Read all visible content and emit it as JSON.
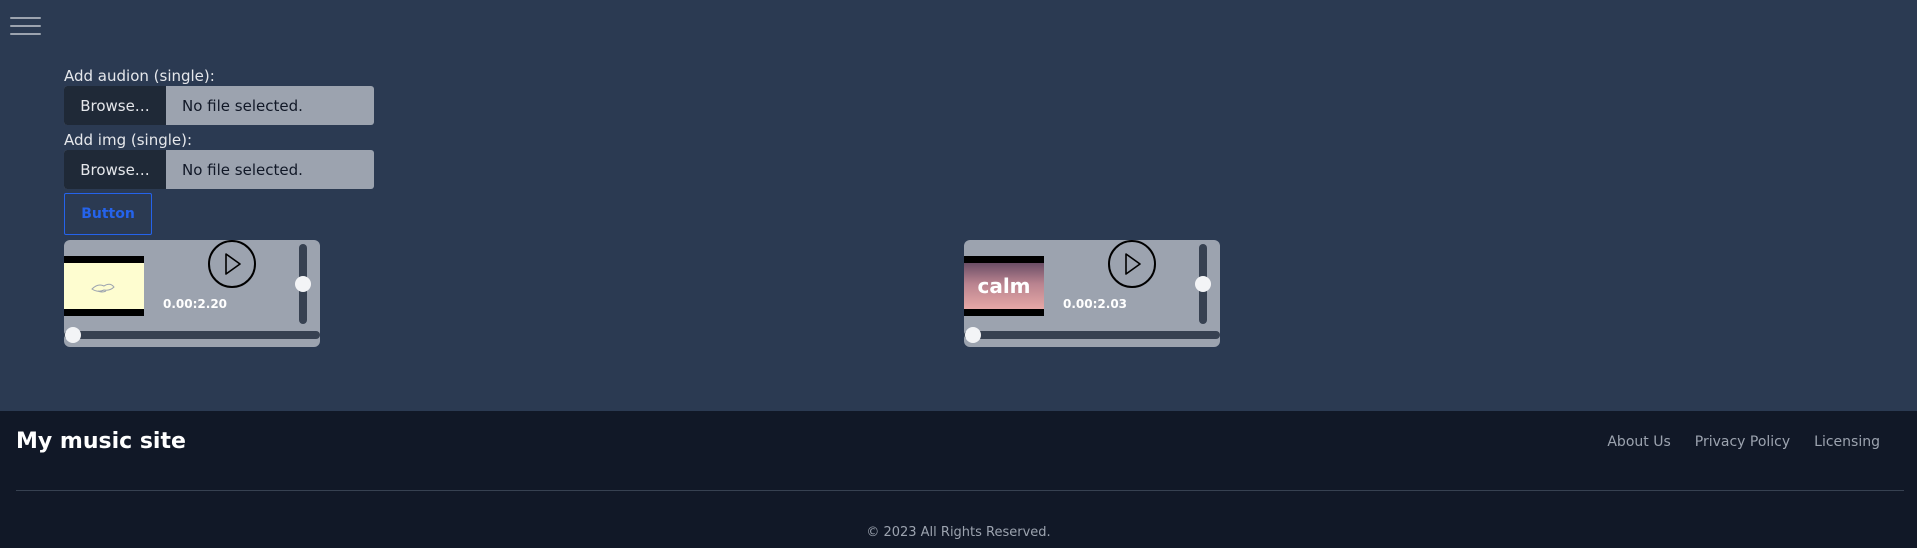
{
  "nav": {
    "menu_icon": "hamburger-menu-icon"
  },
  "form": {
    "audio_label": "Add audion (single):",
    "img_label": "Add img (single):",
    "browse_label": "Browse…",
    "audio_status": "No file selected.",
    "img_status": "No file selected.",
    "button_label": "Button"
  },
  "players": [
    {
      "thumbnail_text": "",
      "time": "0.00:2.20",
      "play_icon": "play-icon"
    },
    {
      "thumbnail_text": "calm",
      "time": "0.00:2.03",
      "play_icon": "play-icon"
    }
  ],
  "footer": {
    "site_title": "My music site",
    "links": [
      "About Us",
      "Privacy Policy",
      "Licensing"
    ],
    "copyright": "© 2023 All Rights Reserved."
  },
  "colors": {
    "page_bg": "#2b3a52",
    "footer_bg": "#111827",
    "accent": "#2563eb",
    "player_bg": "#9ca3af"
  }
}
